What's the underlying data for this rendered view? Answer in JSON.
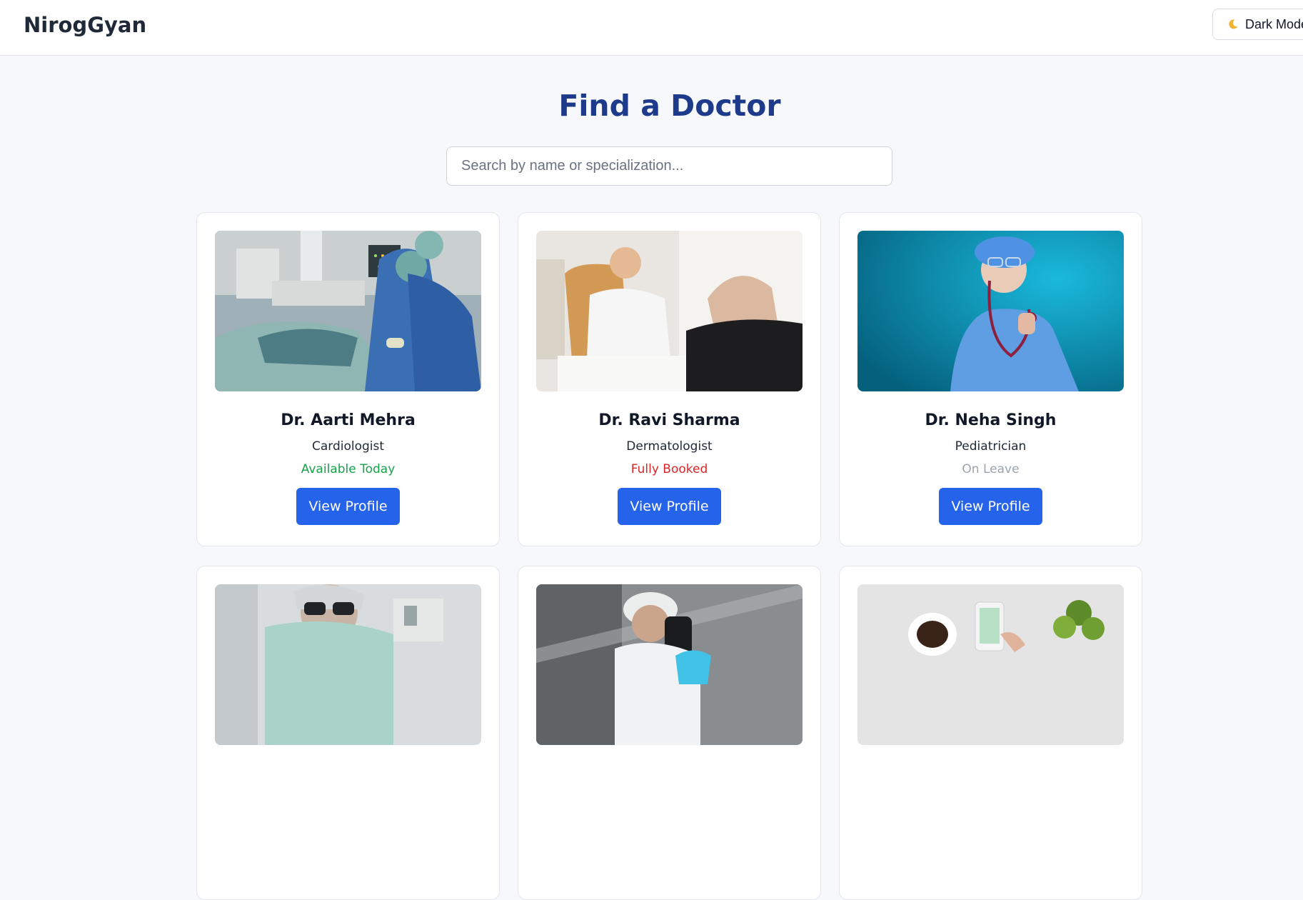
{
  "header": {
    "brand": "NirogGyan",
    "dark_mode_label": "Dark Mode",
    "dark_mode_icon": "moon-icon"
  },
  "main": {
    "title": "Find a Doctor",
    "search": {
      "placeholder": "Search by name or specialization...",
      "value": ""
    }
  },
  "doctors": [
    {
      "name": "Dr. Aarti Mehra",
      "specialization": "Cardiologist",
      "status": "Available Today",
      "status_color": "#16a34a",
      "button": "View Profile"
    },
    {
      "name": "Dr. Ravi Sharma",
      "specialization": "Dermatologist",
      "status": "Fully Booked",
      "status_color": "#dc2626",
      "button": "View Profile"
    },
    {
      "name": "Dr. Neha Singh",
      "specialization": "Pediatrician",
      "status": "On Leave",
      "status_color": "#9ca3af",
      "button": "View Profile"
    },
    {
      "name": "",
      "specialization": "",
      "status": "",
      "status_color": "",
      "button": ""
    },
    {
      "name": "",
      "specialization": "",
      "status": "",
      "status_color": "",
      "button": ""
    },
    {
      "name": "",
      "specialization": "",
      "status": "",
      "status_color": "",
      "button": ""
    }
  ],
  "colors": {
    "accent": "#2563eb",
    "title": "#1e3a8a",
    "available": "#16a34a",
    "booked": "#dc2626",
    "on_leave": "#9ca3af"
  }
}
